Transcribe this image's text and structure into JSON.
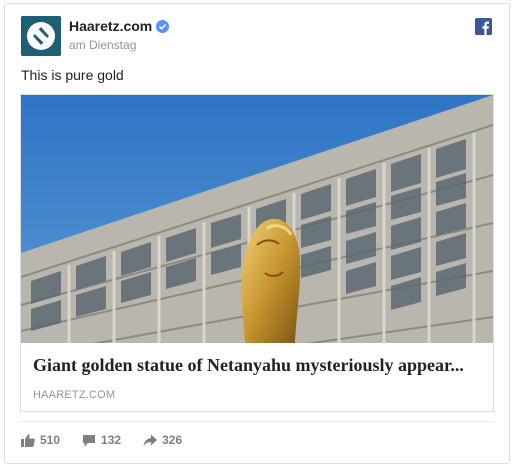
{
  "post": {
    "page_name": "Haaretz.com",
    "timestamp": "am Dienstag",
    "text": "This is pure gold"
  },
  "link": {
    "headline": "Giant golden statue of Netanyahu mysteriously appear...",
    "domain": "HAARETZ.COM"
  },
  "stats": {
    "likes": "510",
    "comments": "132",
    "shares": "326"
  },
  "icons": {
    "avatar": "haaretz-logo-icon",
    "verified": "verified-badge-icon",
    "network": "facebook-logo-icon",
    "likes": "thumbs-up-icon",
    "comments": "comment-icon",
    "shares": "share-arrow-icon"
  },
  "colors": {
    "brand_facebook": "#3b5998",
    "avatar_bg": "#1f5f74",
    "verified": "#5890ff",
    "secondary_text": "#90949c"
  }
}
